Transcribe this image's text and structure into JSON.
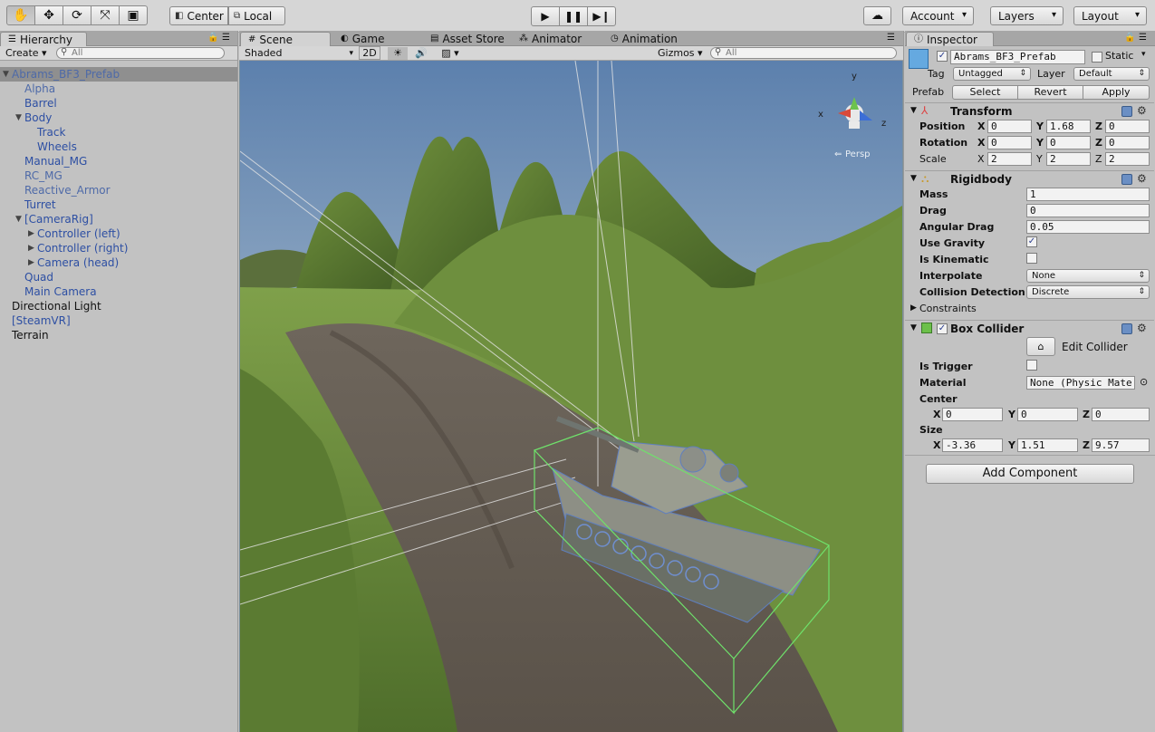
{
  "toolbar": {
    "tools": [
      "hand-tool",
      "move-tool",
      "rotate-tool",
      "scale-tool",
      "rect-tool"
    ],
    "pivot_mode": "Center",
    "pivot_rotation": "Local",
    "account_label": "Account",
    "layers_label": "Layers",
    "layout_label": "Layout"
  },
  "hierarchy": {
    "tab_label": "Hierarchy",
    "create_label": "Create",
    "search_placeholder": "All",
    "items": [
      {
        "label": "Abrams_BF3_Prefab",
        "indent": 0,
        "arrow": "down",
        "selected": true,
        "style": "dim"
      },
      {
        "label": "Alpha",
        "indent": 1,
        "arrow": "",
        "style": "dim"
      },
      {
        "label": "Barrel",
        "indent": 1,
        "arrow": "",
        "style": "blue"
      },
      {
        "label": "Body",
        "indent": 1,
        "arrow": "down",
        "style": "blue"
      },
      {
        "label": "Track",
        "indent": 2,
        "arrow": "",
        "style": "blue"
      },
      {
        "label": "Wheels",
        "indent": 2,
        "arrow": "",
        "style": "blue"
      },
      {
        "label": "Manual_MG",
        "indent": 1,
        "arrow": "",
        "style": "blue"
      },
      {
        "label": "RC_MG",
        "indent": 1,
        "arrow": "",
        "style": "dim"
      },
      {
        "label": "Reactive_Armor",
        "indent": 1,
        "arrow": "",
        "style": "dim"
      },
      {
        "label": "Turret",
        "indent": 1,
        "arrow": "",
        "style": "blue"
      },
      {
        "label": "[CameraRig]",
        "indent": 1,
        "arrow": "down",
        "style": "blue"
      },
      {
        "label": "Controller (left)",
        "indent": 2,
        "arrow": "right",
        "style": "blue"
      },
      {
        "label": "Controller (right)",
        "indent": 2,
        "arrow": "right",
        "style": "blue"
      },
      {
        "label": "Camera (head)",
        "indent": 2,
        "arrow": "right",
        "style": "blue"
      },
      {
        "label": "Quad",
        "indent": 1,
        "arrow": "",
        "style": "blue"
      },
      {
        "label": "Main Camera",
        "indent": 1,
        "arrow": "",
        "style": "blue"
      },
      {
        "label": "Directional Light",
        "indent": 0,
        "arrow": "",
        "style": "black"
      },
      {
        "label": "[SteamVR]",
        "indent": 0,
        "arrow": "",
        "style": "blue"
      },
      {
        "label": "Terrain",
        "indent": 0,
        "arrow": "",
        "style": "black"
      }
    ]
  },
  "scene": {
    "tabs": [
      {
        "label": "Scene",
        "icon": "grid-icon",
        "active": true
      },
      {
        "label": "Game",
        "icon": "pacman-icon",
        "active": false
      },
      {
        "label": "Asset Store",
        "icon": "bag-icon",
        "active": false
      },
      {
        "label": "Animator",
        "icon": "nodes-icon",
        "active": false
      },
      {
        "label": "Animation",
        "icon": "clock-icon",
        "active": false
      }
    ],
    "shading_mode": "Shaded",
    "mode_2d": "2D",
    "gizmos_label": "Gizmos",
    "search_placeholder": "All",
    "persp_label": "Persp",
    "axis_x": "x",
    "axis_y": "y",
    "axis_z": "z"
  },
  "inspector": {
    "tab_label": "Inspector",
    "object_name": "Abrams_BF3_Prefab",
    "static_label": "Static",
    "tag_label": "Tag",
    "tag_value": "Untagged",
    "layer_label": "Layer",
    "layer_value": "Default",
    "prefab_label": "Prefab",
    "prefab_select": "Select",
    "prefab_revert": "Revert",
    "prefab_apply": "Apply",
    "transform": {
      "title": "Transform",
      "position_label": "Position",
      "rotation_label": "Rotation",
      "scale_label": "Scale",
      "position": {
        "x": "0",
        "y": "1.68",
        "z": "0"
      },
      "rotation": {
        "x": "0",
        "y": "0",
        "z": "0"
      },
      "scale": {
        "x": "2",
        "y": "2",
        "z": "2"
      }
    },
    "rigidbody": {
      "title": "Rigidbody",
      "mass_label": "Mass",
      "mass": "1",
      "drag_label": "Drag",
      "drag": "0",
      "angular_drag_label": "Angular Drag",
      "angular_drag": "0.05",
      "use_gravity_label": "Use Gravity",
      "use_gravity": true,
      "is_kinematic_label": "Is Kinematic",
      "is_kinematic": false,
      "interpolate_label": "Interpolate",
      "interpolate": "None",
      "collision_label": "Collision Detection",
      "collision": "Discrete",
      "constraints_label": "Constraints"
    },
    "box_collider": {
      "title": "Box Collider",
      "edit_label": "Edit Collider",
      "is_trigger_label": "Is Trigger",
      "is_trigger": false,
      "material_label": "Material",
      "material": "None (Physic Mate",
      "center_label": "Center",
      "center": {
        "x": "0",
        "y": "0",
        "z": "0"
      },
      "size_label": "Size",
      "size": {
        "x": "-3.36",
        "y": "1.51",
        "z": "9.57"
      }
    },
    "add_component_label": "Add Component"
  }
}
